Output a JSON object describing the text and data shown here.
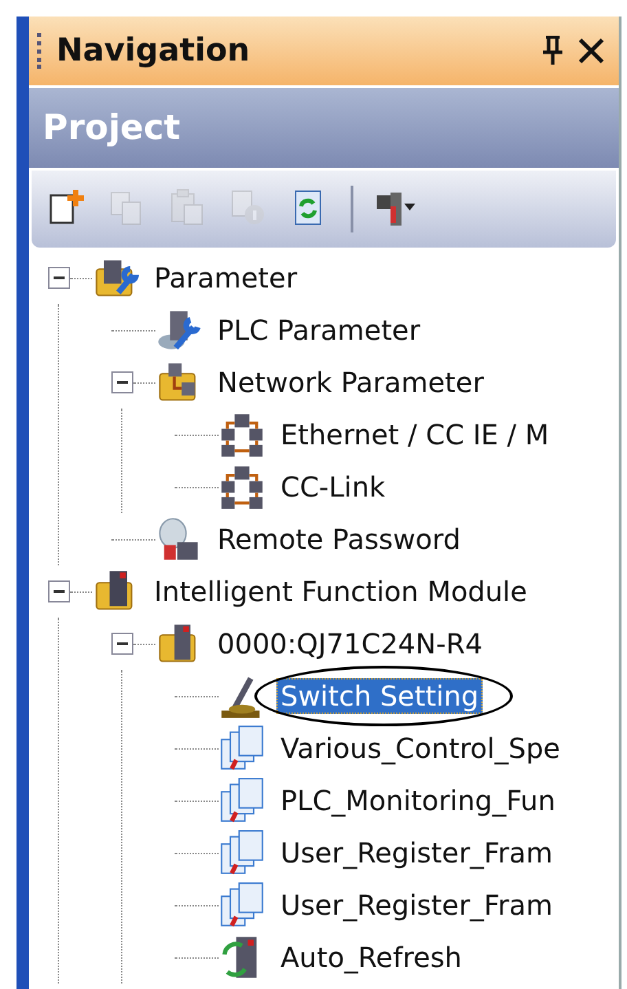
{
  "title_bar": {
    "title": "Navigation"
  },
  "header": {
    "title": "Project"
  },
  "toolbar": [
    {
      "kind": "new",
      "disabled": false
    },
    {
      "kind": "copy",
      "disabled": true
    },
    {
      "kind": "paste",
      "disabled": true
    },
    {
      "kind": "properties",
      "disabled": true
    },
    {
      "kind": "refresh",
      "disabled": false
    },
    {
      "kind": "separator"
    },
    {
      "kind": "network-menu",
      "disabled": false
    }
  ],
  "tree": [
    {
      "label": "Parameter",
      "kind": "parameter",
      "expanded": true,
      "selected": false,
      "children": [
        {
          "label": "PLC Parameter",
          "kind": "plc-parameter",
          "selected": false
        },
        {
          "label": "Network Parameter",
          "kind": "network-folder",
          "expanded": true,
          "selected": false,
          "children": [
            {
              "label": "Ethernet / CC IE / M",
              "kind": "network",
              "selected": false
            },
            {
              "label": "CC-Link",
              "kind": "network",
              "selected": false
            }
          ]
        },
        {
          "label": "Remote Password",
          "kind": "password",
          "selected": false
        }
      ]
    },
    {
      "label": "Intelligent Function Module",
      "kind": "module-folder",
      "expanded": true,
      "selected": false,
      "children": [
        {
          "label": "0000:QJ71C24N-R4",
          "kind": "module",
          "expanded": true,
          "selected": false,
          "children": [
            {
              "label": "Switch Setting",
              "kind": "switch",
              "selected": true
            },
            {
              "label": "Various_Control_Spe",
              "kind": "document",
              "selected": false
            },
            {
              "label": "PLC_Monitoring_Fun",
              "kind": "document",
              "selected": false
            },
            {
              "label": "User_Register_Fram",
              "kind": "document",
              "selected": false
            },
            {
              "label": "User_Register_Fram",
              "kind": "document",
              "selected": false
            },
            {
              "label": "Auto_Refresh",
              "kind": "refresh",
              "selected": false
            }
          ]
        }
      ]
    }
  ]
}
